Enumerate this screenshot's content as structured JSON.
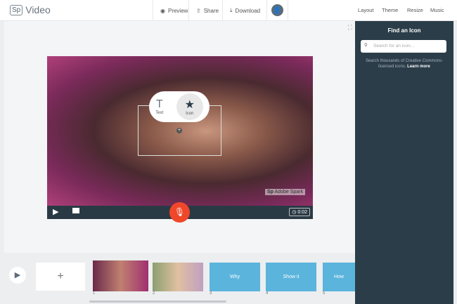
{
  "header": {
    "app": "Video",
    "logo": "Sp",
    "preview": "Preview",
    "share": "Share",
    "download": "Download",
    "nav": [
      "Layout",
      "Theme",
      "Resize",
      "Music"
    ]
  },
  "panel": {
    "title": "Find an Icon",
    "placeholder": "Search for an icon...",
    "desc": "Search thousands of Creative Commons-licensed icons.",
    "learn": "Learn more"
  },
  "video": {
    "popup": {
      "text_icon": "T",
      "text_label": "Text",
      "icon_label": "Icon"
    },
    "watermark": "Adobe Spark",
    "time": "0:02"
  },
  "slides": [
    {
      "num": "1"
    },
    {
      "num": "2"
    },
    {
      "num": "3",
      "label": "Why"
    },
    {
      "num": "4",
      "label": "Show it"
    },
    {
      "num": "5",
      "label": "How"
    }
  ],
  "add": "+"
}
